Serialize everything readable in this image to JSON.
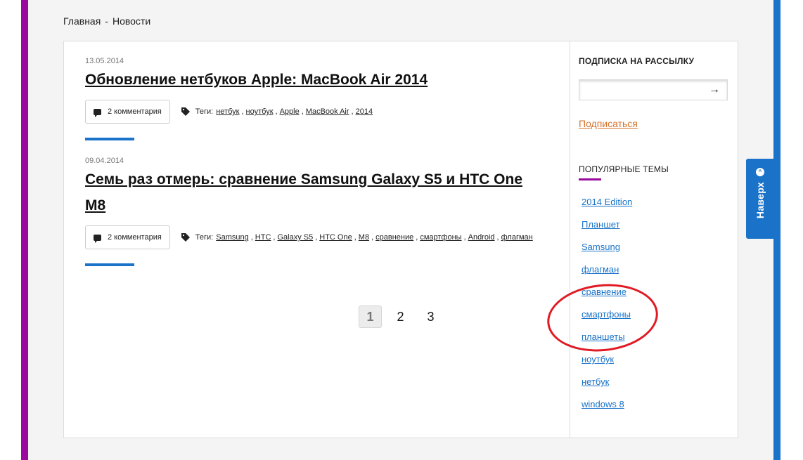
{
  "breadcrumb": {
    "home": "Главная",
    "separator": "-",
    "current": "Новости"
  },
  "posts": [
    {
      "date": "13.05.2014",
      "title_lines": [
        "Обновление нетбуков Apple: MacBook Air 2014"
      ],
      "comments": "2 комментария",
      "tags_label": "Теги:",
      "tags": [
        "нетбук",
        "ноутбук",
        "Apple",
        "MacBook Air",
        "2014"
      ]
    },
    {
      "date": "09.04.2014",
      "title_lines": [
        "Семь раз отмерь: сравнение Samsung Galaxy S5 и HTC One",
        "M8"
      ],
      "comments": "2 комментария",
      "tags_label": "Теги:",
      "tags": [
        "Samsung",
        "HTC",
        "Galaxy S5",
        "HTC One",
        "M8",
        "сравнение",
        "смартфоны",
        "Android",
        "флагман"
      ]
    }
  ],
  "pagination": {
    "pages": [
      "1",
      "2",
      "3"
    ],
    "current": "1"
  },
  "sidebar": {
    "subscribe_heading": "ПОДПИСКА НА РАССЫЛКУ",
    "email_value": "",
    "submit_arrow": "→",
    "subscribe_link": "Подписаться",
    "topics_heading": "ПОПУЛЯРНЫЕ ТЕМЫ",
    "topics": [
      "2014 Edition",
      "Планшет",
      "Samsung",
      "флагман",
      "сравнение",
      "смартфоны",
      "планшеты",
      "ноутбук",
      "нетбук",
      "windows 8"
    ]
  },
  "back_to_top": {
    "label": "Наверх",
    "icon": "chevron-up-circle-icon"
  },
  "colors": {
    "left_border": "#9a0a9e",
    "right_border": "#1a73c9",
    "accent_blue": "#1a73c9",
    "topics_accent": "#9a0a9e",
    "subscribe_link": "#d6722d",
    "annotation_ellipse": "#e01b24"
  }
}
